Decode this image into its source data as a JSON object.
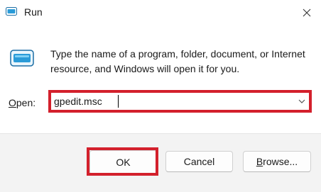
{
  "window": {
    "title": "Run",
    "title_icon": "run-icon",
    "close_icon": "close-icon"
  },
  "body": {
    "icon": "run-app-icon",
    "description": "Type the name of a program, folder, document, or Internet resource, and Windows will open it for you."
  },
  "open": {
    "label_prefix": "O",
    "label_rest": "pen:",
    "value": "gpedit.msc",
    "dropdown_icon": "chevron-down-icon"
  },
  "buttons": {
    "ok": "OK",
    "cancel": "Cancel",
    "browse_prefix": "B",
    "browse_rest": "rowse..."
  },
  "colors": {
    "highlight": "#d3202c",
    "footer_bg": "#f3f3f3",
    "icon_accent": "#2a9bd8"
  }
}
